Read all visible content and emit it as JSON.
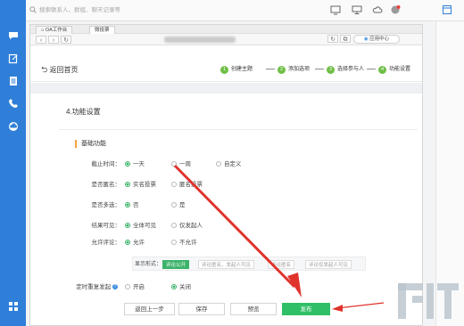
{
  "topbar": {
    "search_placeholder": "搜索联系人、群组、聊天记录等",
    "icons": [
      "screen-share-icon",
      "monitor-icon",
      "cloud-icon",
      "badge-icon",
      "window-icon"
    ]
  },
  "rail": {
    "icons": [
      "chat-icon",
      "edit-icon",
      "document-icon",
      "phone-icon",
      "cloud-icon",
      "apps-icon"
    ]
  },
  "window": {
    "tabs": [
      "OA工作台",
      "微投票"
    ],
    "app_center": "应用中心",
    "back_label": "返回首页",
    "steps": [
      {
        "num": "1",
        "label": "创建主题"
      },
      {
        "num": "2",
        "label": "添加选项"
      },
      {
        "num": "3",
        "label": "选择参与人"
      },
      {
        "num": "4",
        "label": "功能设置"
      }
    ],
    "section_title": "4.功能设置",
    "subsection": "基础功能"
  },
  "settings": {
    "deadline": {
      "label": "截止时间：",
      "options": [
        "一天",
        "一周",
        "自定义"
      ],
      "selected": 0
    },
    "anonymous": {
      "label": "是否匿名：",
      "options": [
        "实名投票",
        "匿名投票"
      ],
      "selected": 0
    },
    "multi": {
      "label": "是否多选：",
      "options": [
        "否",
        "是"
      ],
      "selected": 0
    },
    "result": {
      "label": "结果可见：",
      "options": [
        "全体可见",
        "仅发起人"
      ],
      "selected": 0
    },
    "comment": {
      "label": "允许评论：",
      "options": [
        "允许",
        "不允许"
      ],
      "selected": 0
    },
    "display": {
      "label": "显示形式：",
      "chips": [
        "评论公开",
        "评论匿名，发起人可见",
        "评论匿名",
        "评论仅发起人可见"
      ],
      "selected": 0
    },
    "repeat": {
      "label": "定时重复发起",
      "options": [
        "开启",
        "关闭"
      ],
      "selected": 1
    }
  },
  "buttons": {
    "prev": "返回上一步",
    "save": "保存",
    "preview": "预览",
    "publish": "发布"
  },
  "colors": {
    "accent": "#2fbf66",
    "rail": "#2f7fd8",
    "step": "#6fbf46",
    "annotation": "#e0332c"
  }
}
